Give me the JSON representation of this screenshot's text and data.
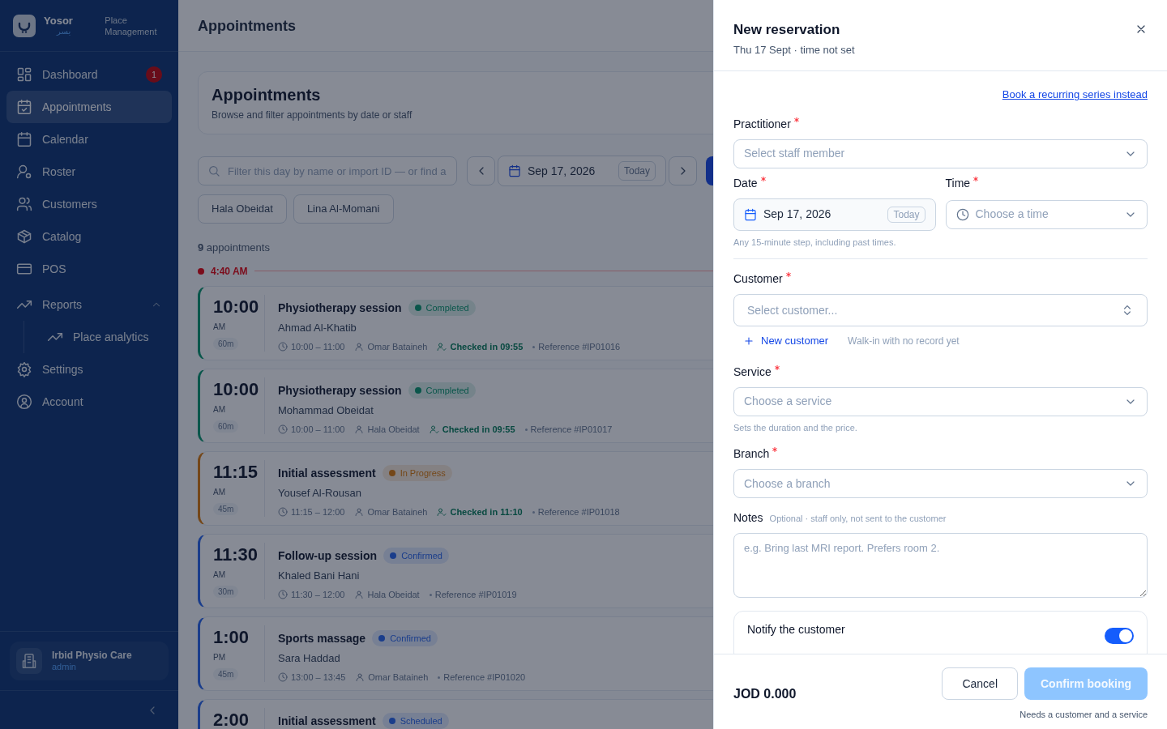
{
  "sidebar": {
    "brand": {
      "name": "Yosor",
      "arabic": "يسر",
      "subtitle": "Place Management"
    },
    "items": [
      {
        "label": "Dashboard",
        "selected": false,
        "badge": "1"
      },
      {
        "label": "Appointments",
        "selected": true
      },
      {
        "label": "Calendar",
        "selected": false
      },
      {
        "label": "Roster",
        "selected": false
      },
      {
        "label": "Customers",
        "selected": false
      },
      {
        "label": "Catalog",
        "selected": false
      },
      {
        "label": "POS",
        "selected": false
      },
      {
        "label": "Reports",
        "selected": false,
        "expanded": true,
        "children": [
          {
            "label": "Place analytics",
            "selected": false
          }
        ]
      },
      {
        "label": "Settings",
        "selected": false
      },
      {
        "label": "Account",
        "selected": false
      }
    ],
    "workspace": {
      "name": "Irbid Physio Care",
      "role": "admin"
    }
  },
  "header": {
    "title": "Appointments"
  },
  "page_card": {
    "title": "Appointments",
    "subtitle": "Browse and filter appointments by date or staff"
  },
  "toolbar": {
    "search": {
      "placeholder": "Filter this day by name or import ID — or find a"
    },
    "date": "Sep 17, 2026",
    "today": "Today"
  },
  "staff_filters": [
    {
      "label": "Hala Obeidat",
      "selected": false
    },
    {
      "label": "Lina Al-Momani",
      "selected": false
    }
  ],
  "count": "**9** appointments",
  "now_marker": "4:40 AM",
  "appointments": [
    {
      "time": "10:00",
      "period": "AM",
      "duration": "60m",
      "title": "Physiotherapy session",
      "status": "Completed",
      "color": "#0a564a",
      "customer": "Ahmad Al-Khatib",
      "range": "10:00 – 11:00",
      "staff": "Omar Bataineh",
      "checked_in": "Checked in 09:55",
      "reference": "Reference #IP01016"
    },
    {
      "time": "10:00",
      "period": "AM",
      "duration": "60m",
      "title": "Physiotherapy session",
      "status": "Completed",
      "color": "#0a564a",
      "customer": "Mohammad Obeidat",
      "range": "10:00 – 11:00",
      "staff": "Hala Obeidat",
      "checked_in": "Checked in 09:55",
      "reference": "Reference #IP01017"
    },
    {
      "time": "11:15",
      "period": "AM",
      "duration": "45m",
      "title": "Initial assessment",
      "status": "In Progress",
      "color": "#744718",
      "customer": "Yousef Al-Rousan",
      "range": "11:15 – 12:00",
      "staff": "Omar Bataineh",
      "checked_in": "Checked in 11:10",
      "reference": "Reference #IP01018"
    },
    {
      "time": "11:30",
      "period": "AM",
      "duration": "30m",
      "title": "Follow-up session",
      "status": "Confirmed",
      "color": "#1a3d8a",
      "customer": "Khaled Bani Hani",
      "range": "11:30 – 12:00",
      "staff": "Hala Obeidat",
      "reference": "Reference #IP01019"
    },
    {
      "time": "1:00",
      "period": "PM",
      "duration": "45m",
      "title": "Sports massage",
      "status": "Confirmed",
      "color": "#1a3d8a",
      "customer": "Sara Haddad",
      "range": "13:00 – 13:45",
      "staff": "Omar Bataineh",
      "reference": "Reference #IP01020"
    },
    {
      "time": "2:00",
      "title": "Initial assessment",
      "status": "Scheduled",
      "color": "#1a3d8a"
    }
  ],
  "drawer": {
    "title": "New reservation",
    "subtitle": "Thu 17 Sept · time not set",
    "recurring_link": "Book a recurring series instead",
    "practitioner": {
      "label": "Practitioner",
      "required": true,
      "placeholder": "Select staff member"
    },
    "date": {
      "label": "Date",
      "required": true,
      "value": "Sep 17, 2026",
      "today": "Today"
    },
    "time": {
      "label": "Time",
      "required": true,
      "placeholder": "Choose a time"
    },
    "date_hint": "Any 15-minute step, including past times.",
    "customer": {
      "label": "Customer",
      "required": true,
      "placeholder": "Select customer..."
    },
    "new_customer": "New customer",
    "walk_in": "Walk-in with no record yet",
    "service": {
      "label": "Service",
      "required": true,
      "placeholder": "Choose a service"
    },
    "service_hint": "Sets the duration and the price.",
    "branch": {
      "label": "Branch",
      "required": true,
      "placeholder": "Choose a branch"
    },
    "notes": {
      "label": "Notes",
      "hint": "Optional · staff only, not sent to the customer",
      "placeholder": "e.g. Bring last MRI report. Prefers room 2."
    },
    "notify": {
      "label": "Notify the customer",
      "on": true
    },
    "total": "JOD 0.000",
    "cancel": "Cancel",
    "confirm": {
      "label": "Confirm booking",
      "disabled": true
    },
    "confirm_hint": "Needs a customer and a service"
  }
}
